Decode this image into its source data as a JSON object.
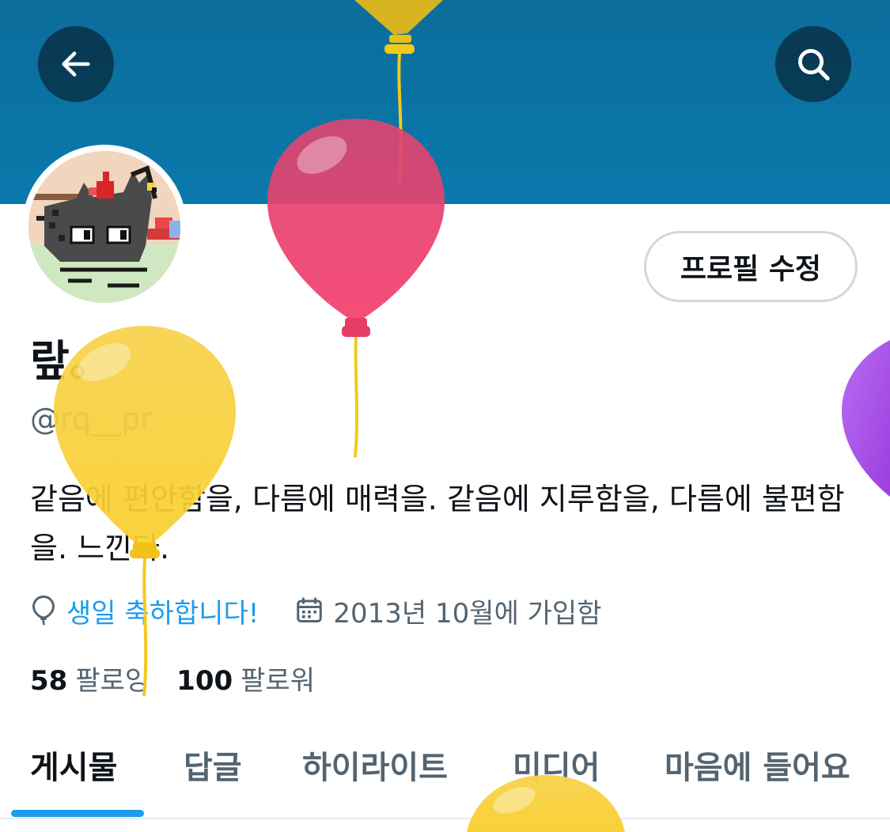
{
  "header": {
    "back_icon": "arrow-left-icon",
    "search_icon": "search-icon",
    "banner_color": "#0a79ab"
  },
  "profile": {
    "edit_button": "프로필 수정",
    "display_name": "랖。",
    "handle": "@rq__pr",
    "bio": "같음에 편안함을, 다름에 매력을. 같음에 지루함을, 다름에 불편함을. 느낀다.",
    "birthday": "생일 축하합니다!",
    "joined": "2013년 10월에 가입함",
    "following_count": "58",
    "following_label": "팔로잉",
    "followers_count": "100",
    "followers_label": "팔로워"
  },
  "tabs": [
    {
      "label": "게시물",
      "active": true
    },
    {
      "label": "답글",
      "active": false
    },
    {
      "label": "하이라이트",
      "active": false
    },
    {
      "label": "미디어",
      "active": false
    },
    {
      "label": "마음에 들어요",
      "active": false
    }
  ],
  "colors": {
    "accent": "#1d9bf0",
    "secondary_text": "#536471",
    "primary_text": "#0f1419"
  }
}
